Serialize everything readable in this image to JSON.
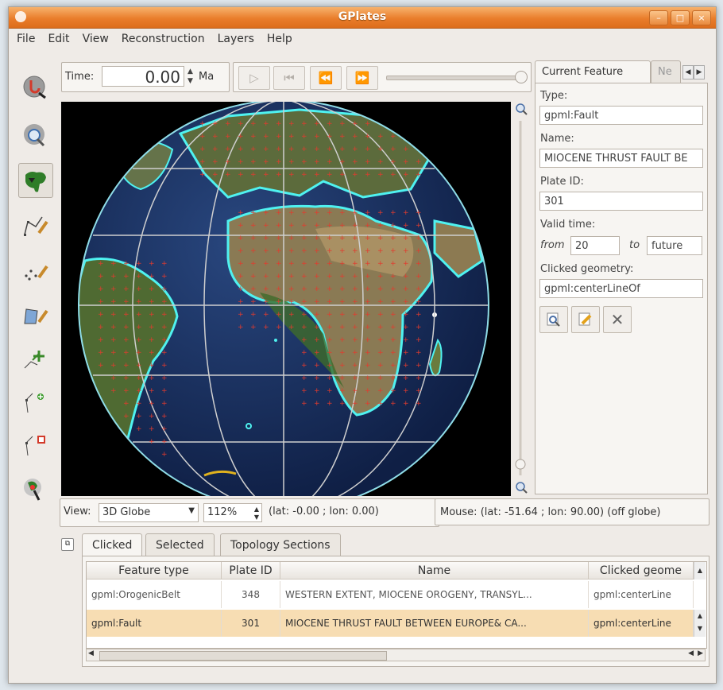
{
  "window": {
    "title": "GPlates"
  },
  "menu": [
    "File",
    "Edit",
    "View",
    "Reconstruction",
    "Layers",
    "Help"
  ],
  "timebar": {
    "label": "Time:",
    "value": "0.00",
    "unit": "Ma"
  },
  "globe": {
    "view_mode": "3D Globe",
    "zoom": "112%",
    "center": "(lat: -0.00 ; lon: 0.00)"
  },
  "mouse_status": "Mouse: (lat: -51.64 ; lon: 90.00) (off globe)",
  "side_panel": {
    "tabs": [
      "Current Feature",
      "Ne"
    ],
    "type_label": "Type:",
    "type_value": "gpml:Fault",
    "name_label": "Name:",
    "name_value": "MIOCENE THRUST FAULT BE",
    "plate_label": "Plate ID:",
    "plate_value": "301",
    "valid_label": "Valid time:",
    "from_label": "from",
    "from_value": "20",
    "to_label": "to",
    "to_value": "future",
    "geom_label": "Clicked geometry:",
    "geom_value": "gpml:centerLineOf"
  },
  "bottom": {
    "tabs": [
      "Clicked",
      "Selected",
      "Topology Sections"
    ],
    "columns": [
      "Feature type",
      "Plate ID",
      "Name",
      "Clicked geome"
    ],
    "rows": [
      {
        "type": "gpml:OrogenicBelt",
        "plate": "348",
        "name": "WESTERN EXTENT, MIOCENE OROGENY, TRANSYL...",
        "geom": "gpml:centerLine"
      },
      {
        "type": "gpml:Fault",
        "plate": "301",
        "name": "MIOCENE THRUST FAULT BETWEEN EUROPE& CA...",
        "geom": "gpml:centerLine"
      }
    ]
  },
  "colors": {
    "titlebar": "#e97d2b",
    "selected_row": "#f7ddb3",
    "coastline": "#4ff2f0",
    "plate_marker": "#e23b2e"
  },
  "icons": [
    "drag-globe-icon",
    "zoom-icon",
    "choose-feature-icon",
    "digitise-polyline-icon",
    "digitise-multipoint-icon",
    "digitise-polygon-icon",
    "move-vertex-icon",
    "insert-vertex-icon",
    "delete-vertex-icon",
    "manipulate-pole-icon"
  ]
}
